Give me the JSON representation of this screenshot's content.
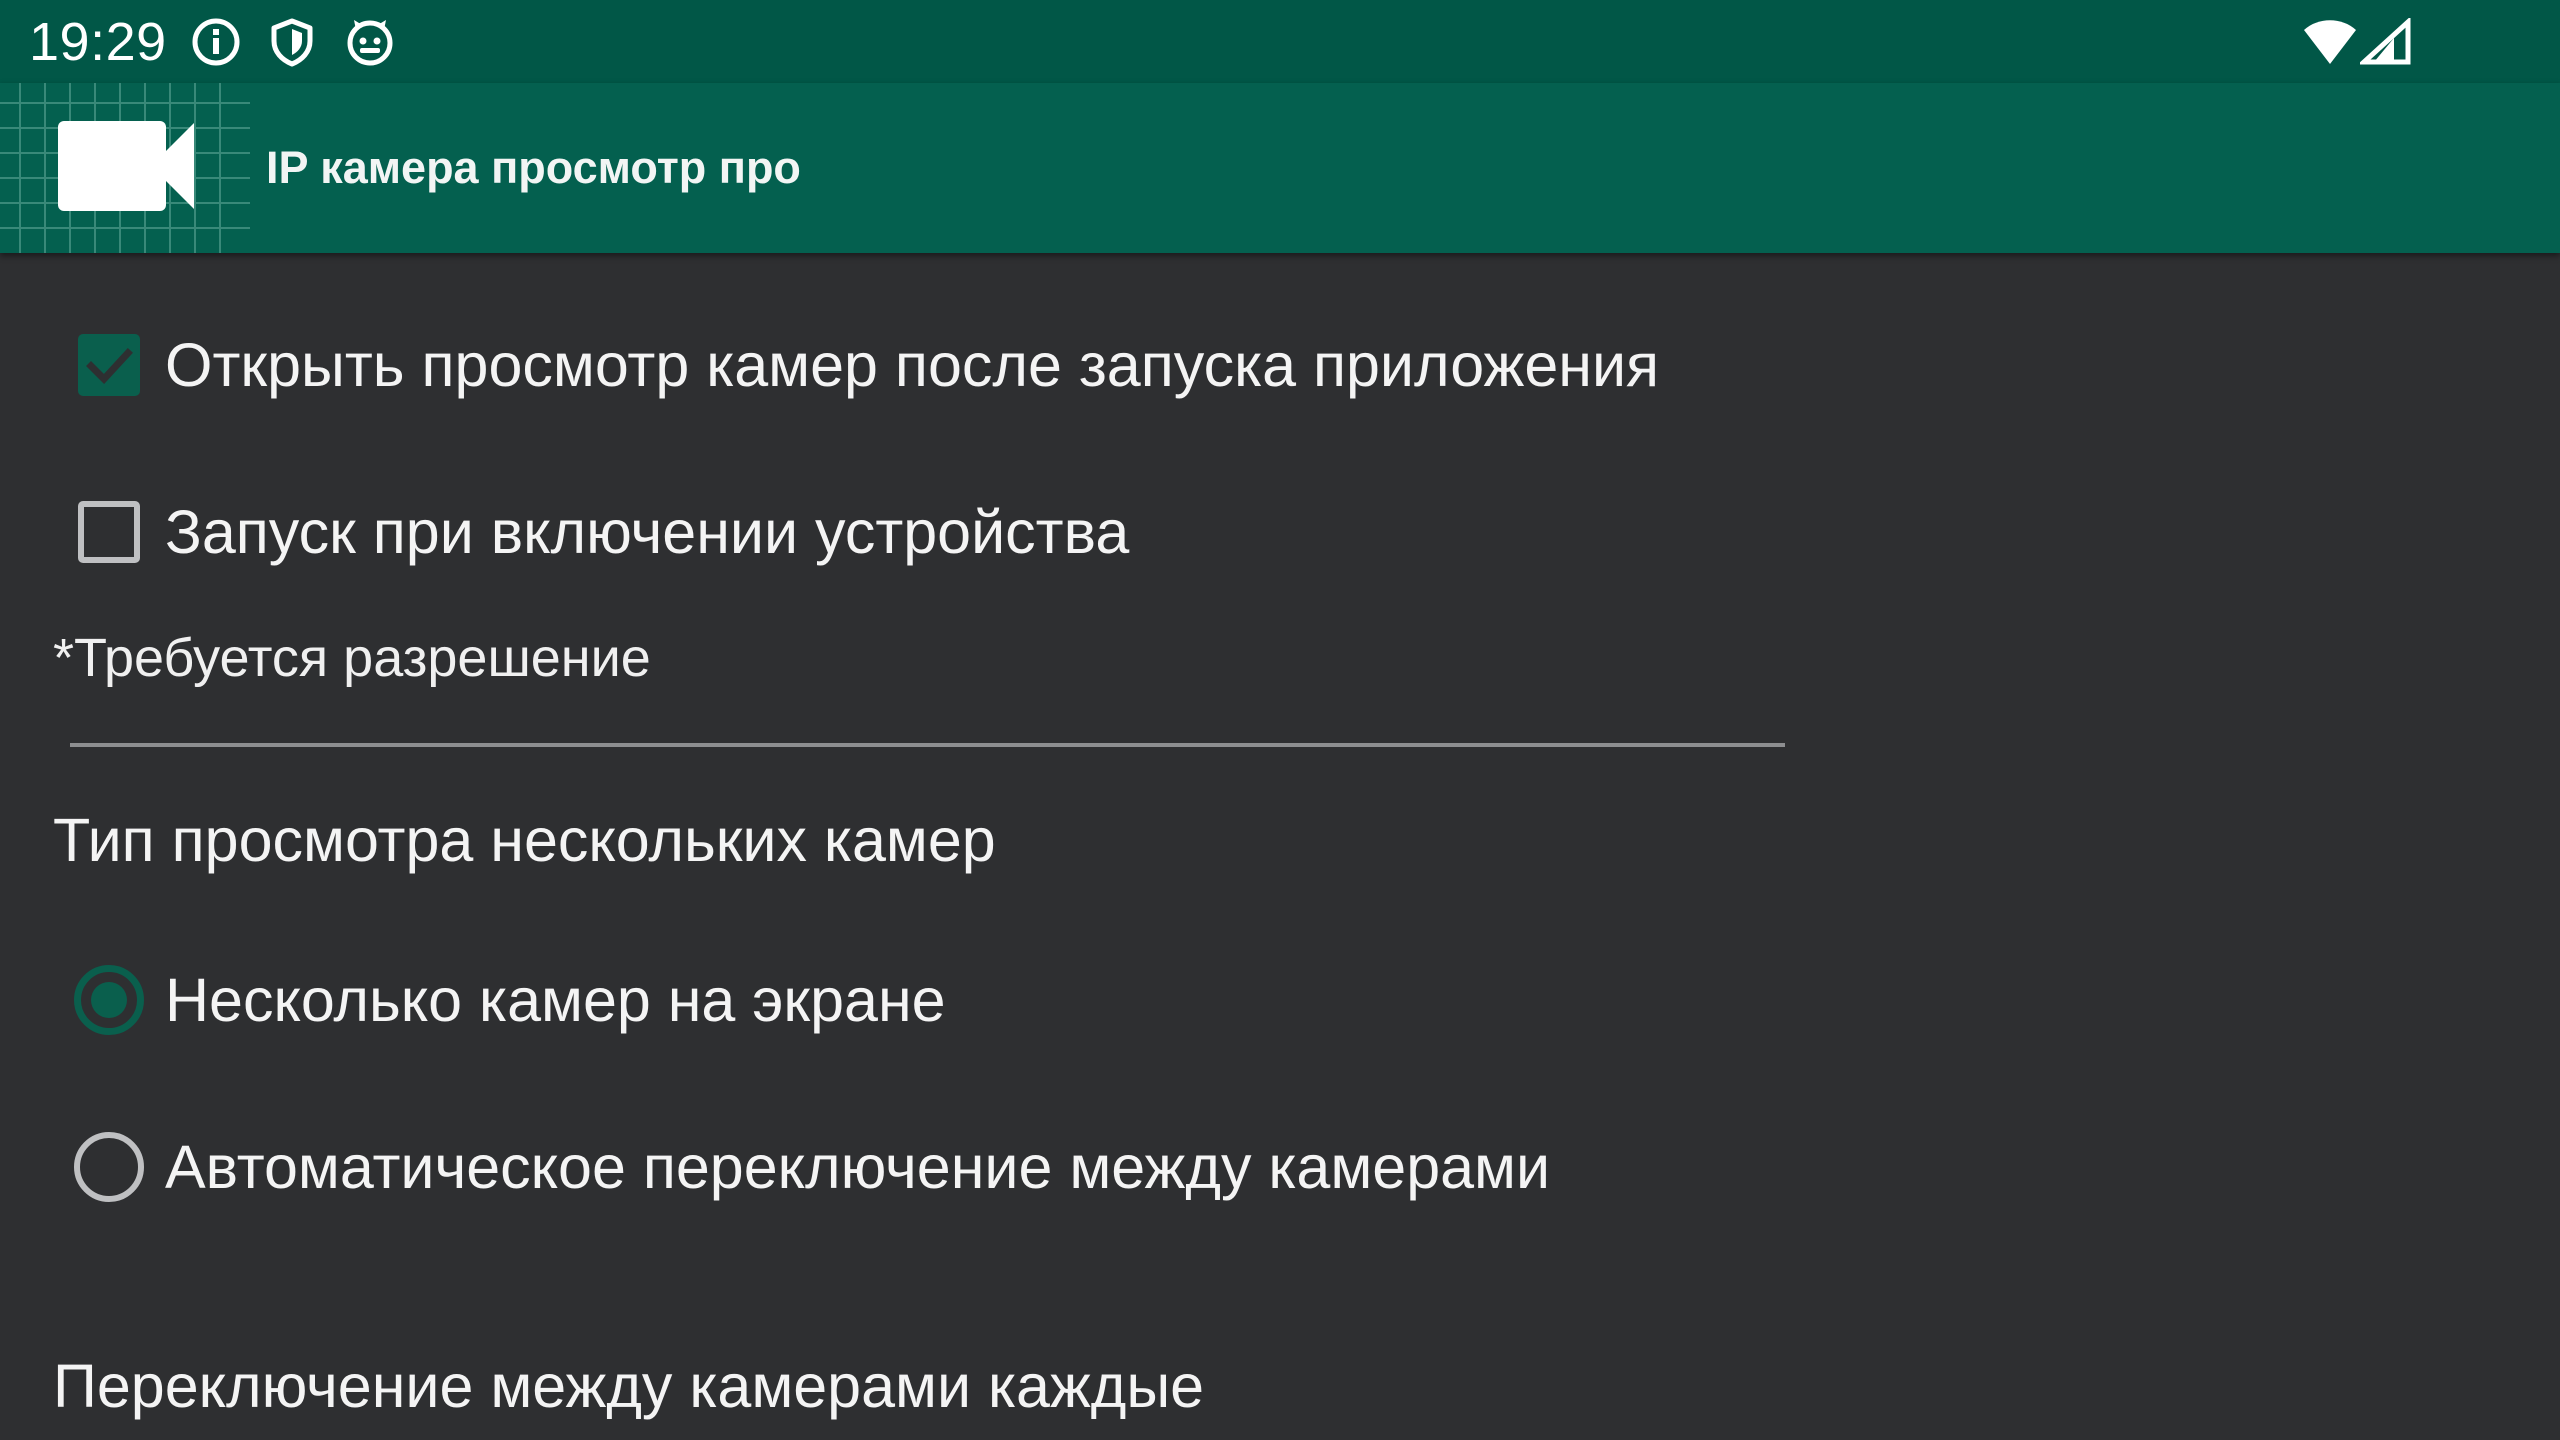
{
  "status_bar": {
    "time": "19:29",
    "icons": [
      "info-icon",
      "shield-icon",
      "cat-face-icon",
      "wifi-icon",
      "cellular-signal-icon"
    ],
    "background": "#015747"
  },
  "app_bar": {
    "title": "IP камера просмотр про",
    "logo_icon": "video-camera-icon",
    "background": "#04604f"
  },
  "settings": {
    "open_on_start": {
      "label": "Открыть просмотр камер после запуска приложения",
      "checked": true
    },
    "start_on_boot": {
      "label": "Запуск при включении устройства",
      "checked": false
    },
    "permission_note": "*Требуется разрешение",
    "multi_view": {
      "title": "Тип просмотра нескольких камер",
      "options": [
        {
          "label": "Несколько камер на экране",
          "selected": true
        },
        {
          "label": "Автоматическое переключение между камерами",
          "selected": false
        }
      ]
    },
    "switch_interval_title": "Переключение между камерами каждые"
  },
  "colors": {
    "accent": "#0a5f4d",
    "background": "#2e2f31",
    "text": "#f4f4f4",
    "unchecked": "#bfc0c2"
  }
}
